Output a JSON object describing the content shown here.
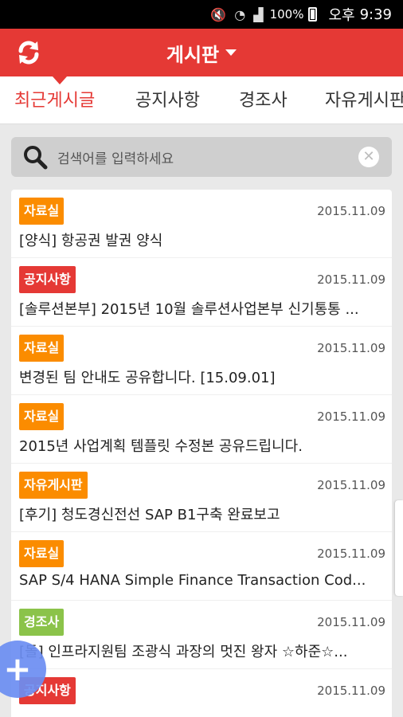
{
  "status_bar": {
    "battery": "100%",
    "ampm": "오후",
    "time": "9:39",
    "icons": [
      "mute-icon",
      "wifi-icon",
      "signal-icon",
      "battery-icon"
    ]
  },
  "app_bar": {
    "title": "게시판",
    "refresh_icon": "refresh-icon",
    "color": "#e53935"
  },
  "tabs": [
    "최근게시글",
    "공지사항",
    "경조사",
    "자유게시판"
  ],
  "active_tab": "최근게시글",
  "search": {
    "placeholder": "검색어를 입력하세요"
  },
  "posts": [
    {
      "category": "자료실",
      "color": "#fb8c00",
      "date": "2015.11.09",
      "title": "[양식] 항공권 발권 양식"
    },
    {
      "category": "공지사항",
      "color": "#e53935",
      "date": "2015.11.09",
      "title": "[솔루션본부] 2015년 10월 솔루션사업본부 신기통통 ..."
    },
    {
      "category": "자료실",
      "color": "#fb8c00",
      "date": "2015.11.09",
      "title": "변경된 팀 안내도 공유합니다. [15.09.01]"
    },
    {
      "category": "자료실",
      "color": "#fb8c00",
      "date": "2015.11.09",
      "title": "2015년 사업계획 템플릿 수정본 공유드립니다."
    },
    {
      "category": "자유게시판",
      "color": "#fb8c00",
      "date": "2015.11.09",
      "title": "[후기] 청도경신전선 SAP B1구축 완료보고"
    },
    {
      "category": "자료실",
      "color": "#fb8c00",
      "date": "2015.11.09",
      "title": "SAP S/4 HANA Simple Finance Transaction Cod..."
    },
    {
      "category": "경조사",
      "color": "#8bc34a",
      "date": "2015.11.09",
      "title": "[돌] 인프라지원팀 조광식 과장의 멋진 왕자 ☆하준☆..."
    },
    {
      "category": "공지사항",
      "color": "#e53935",
      "date": "2015.11.09",
      "title": ""
    }
  ],
  "fab": {
    "label": "+",
    "color": "#6c8ef2"
  }
}
